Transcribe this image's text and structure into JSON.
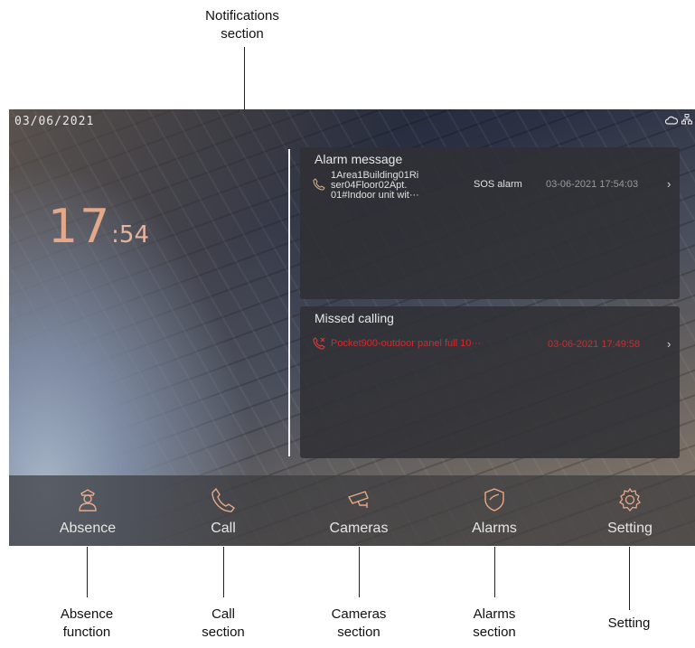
{
  "annotations": {
    "notifications": [
      "Notifications",
      "section"
    ],
    "absence": [
      "Absence",
      "function"
    ],
    "call": [
      "Call",
      "section"
    ],
    "cameras": [
      "Cameras",
      "section"
    ],
    "alarms": [
      "Alarms",
      "section"
    ],
    "setting": "Setting"
  },
  "statusbar": {
    "date": "03/06/2021",
    "icons": [
      "cloud-icon",
      "network-icon"
    ]
  },
  "clock": {
    "hours": "17",
    "minutes": ":54"
  },
  "alarm_panel": {
    "title": "Alarm message",
    "entry": {
      "source_lines": [
        "1Area1Building01Ri",
        "ser04Floor02Apt.",
        "01#Indoor unit wit···"
      ],
      "type": "SOS alarm",
      "timestamp": "03-06-2021 17:54:03",
      "chevron": "›"
    }
  },
  "missed_panel": {
    "title": "Missed calling",
    "entry": {
      "source": "Pocket900-outdoor panel full 10···",
      "timestamp": "03-06-2021 17:49:58",
      "chevron": "›"
    }
  },
  "nav": [
    {
      "label": "Absence",
      "icon": "guard-icon"
    },
    {
      "label": "Call",
      "icon": "phone-icon"
    },
    {
      "label": "Cameras",
      "icon": "camera-icon"
    },
    {
      "label": "Alarms",
      "icon": "shield-icon"
    },
    {
      "label": "Setting",
      "icon": "gear-icon"
    }
  ],
  "colors": {
    "clock": "#e3a88a",
    "accent": "#c9aa8a",
    "missed": "#d42a2a"
  }
}
